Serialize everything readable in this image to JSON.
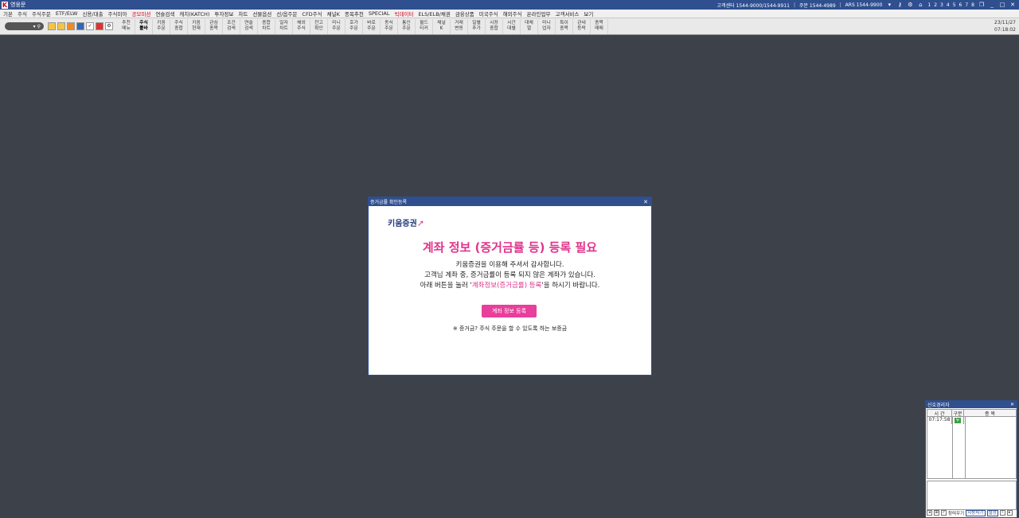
{
  "window": {
    "title": "영웅문",
    "right_info": [
      "고객센터 1544-9000/1544-9911",
      "주문 1544-4989",
      "ARS 1544-9900"
    ],
    "window_nums": [
      "1",
      "2",
      "3",
      "4",
      "5",
      "6",
      "7",
      "8"
    ]
  },
  "menu": [
    {
      "label": "기본",
      "red": false
    },
    {
      "label": "주식",
      "red": false
    },
    {
      "label": "주식주문",
      "red": false
    },
    {
      "label": "ETF/ELW",
      "red": false
    },
    {
      "label": "신용/대출",
      "red": false
    },
    {
      "label": "주식미아",
      "red": false
    },
    {
      "label": "공모미션",
      "red": true
    },
    {
      "label": "연슬검색",
      "red": false
    },
    {
      "label": "캐치(KATCH)",
      "red": false
    },
    {
      "label": "투자정보",
      "red": false
    },
    {
      "label": "차트",
      "red": false
    },
    {
      "label": "선물옵션",
      "red": false
    },
    {
      "label": "선/옵주문",
      "red": false
    },
    {
      "label": "CFD주식",
      "red": false
    },
    {
      "label": "채널K",
      "red": false
    },
    {
      "label": "종목추천",
      "red": false
    },
    {
      "label": "SPECIAL",
      "red": false
    },
    {
      "label": "빅데이터",
      "red": true
    },
    {
      "label": "ELS/ELB/채권",
      "red": false
    },
    {
      "label": "금융상품",
      "red": false
    },
    {
      "label": "미국주식",
      "red": false
    },
    {
      "label": "해외주식",
      "red": false
    },
    {
      "label": "온라인업무",
      "red": false
    },
    {
      "label": "고객서비스",
      "red": false
    },
    {
      "label": "보기",
      "red": false
    }
  ],
  "toolbar": {
    "buttons": [
      {
        "l1": "추천",
        "l2": "메뉴"
      },
      {
        "l1": "주식",
        "l2": "툴바"
      },
      {
        "l1": "키움",
        "l2": "주문"
      },
      {
        "l1": "주식",
        "l2": "종합"
      },
      {
        "l1": "키움",
        "l2": "현재"
      },
      {
        "l1": "관심",
        "l2": "종목"
      },
      {
        "l1": "조건",
        "l2": "검색"
      },
      {
        "l1": "연슬",
        "l2": "검색"
      },
      {
        "l1": "종합",
        "l2": "차트"
      },
      {
        "l1": "일자",
        "l2": "차트"
      },
      {
        "l1": "해외",
        "l2": "주식"
      },
      {
        "l1": "잔고",
        "l2": "확인"
      },
      {
        "l1": "미니",
        "l2": "주문"
      },
      {
        "l1": "호가",
        "l2": "주문"
      },
      {
        "l1": "바로",
        "l2": "주문"
      },
      {
        "l1": "동식",
        "l2": "주문"
      },
      {
        "l1": "통인",
        "l2": "주문"
      },
      {
        "l1": "월드",
        "l2": "티커"
      },
      {
        "l1": "채널",
        "l2": "K"
      },
      {
        "l1": "거래",
        "l2": "변동"
      },
      {
        "l1": "일별",
        "l2": "추가"
      },
      {
        "l1": "시장",
        "l2": "종합"
      },
      {
        "l1": "시간",
        "l2": "대별"
      },
      {
        "l1": "대체",
        "l2": "열"
      },
      {
        "l1": "미니",
        "l2": "업자"
      },
      {
        "l1": "특이",
        "l2": "종목"
      },
      {
        "l1": "관네",
        "l2": "등락"
      },
      {
        "l1": "종목",
        "l2": "매매"
      }
    ],
    "date": "23/11/27",
    "time": "07:18:02"
  },
  "dialog": {
    "title": "증거금률 확인등록",
    "brand": "키움증권",
    "heading": "계좌 정보 (증거금률 등) 등록 필요",
    "line1": "키움증권을 이용해 주셔서 감사합니다.",
    "line2": "고객님 계좌 중, 증거금률이 등록 되지 않은 계좌가 있습니다.",
    "line3_pre": "아래 버튼을 눌러 '",
    "line3_pink": "계좌정보(증거금률) 등록",
    "line3_post": "'을 하시기 바랍니다.",
    "button": "계좌 정보 등록",
    "note": "※ 증거금? 주식 주문을 할 수 있도록 하는 보증금"
  },
  "signal": {
    "title": "신호경리자",
    "headers": [
      "시 간",
      "구분",
      "종 목"
    ],
    "rows": [
      {
        "time": "07:17:58",
        "kind": "뉴"
      }
    ],
    "bottom_check": "창띄우기",
    "tag1": "자동띄기",
    "tag2": "설정"
  }
}
